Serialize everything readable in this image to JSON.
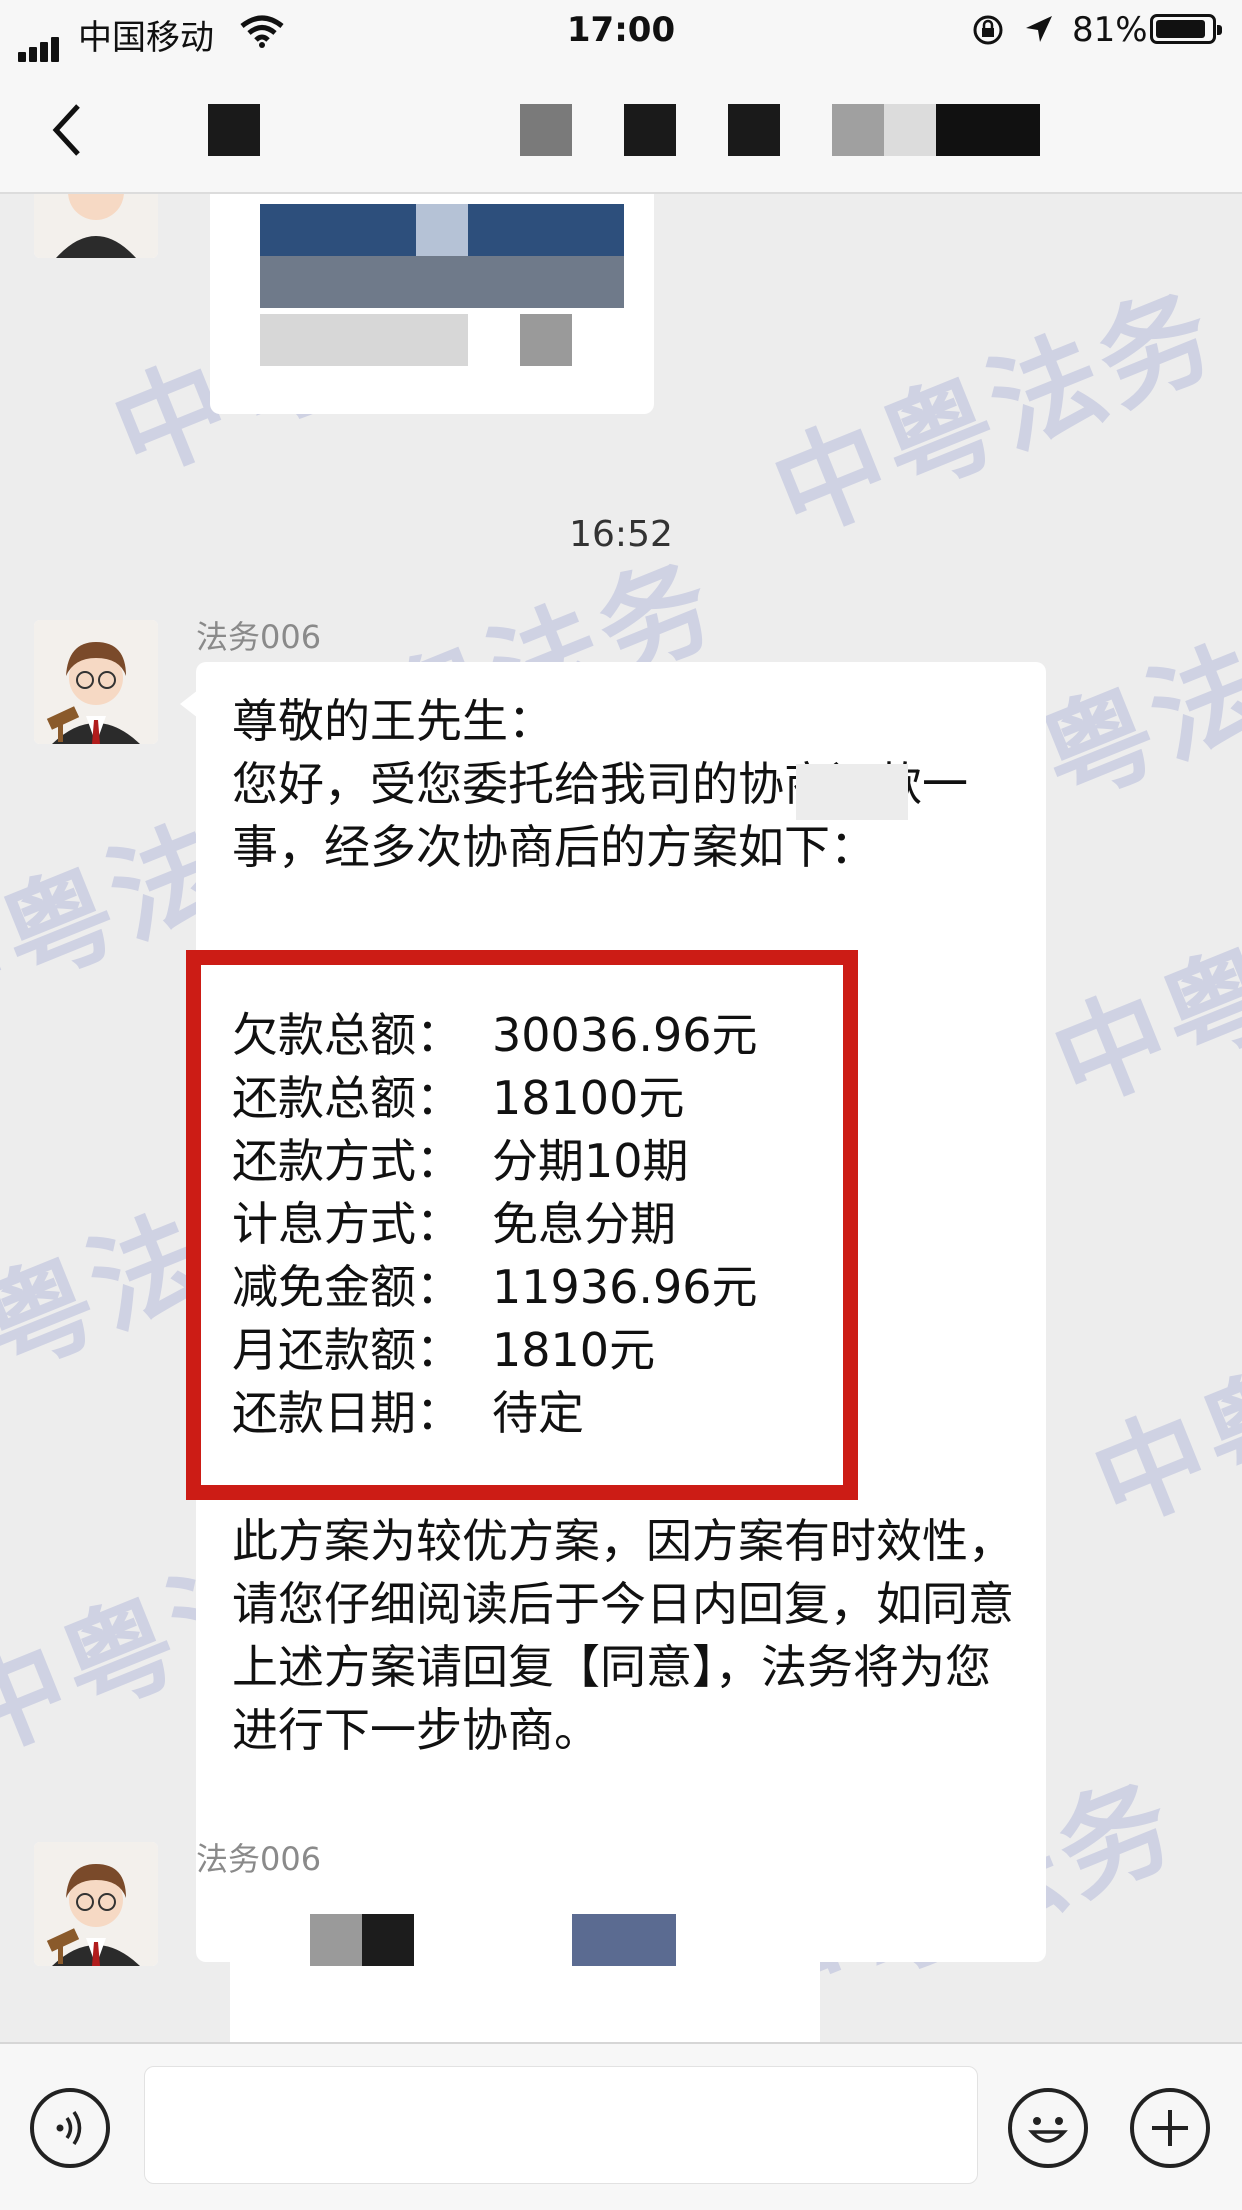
{
  "status_bar": {
    "carrier": "中国移动",
    "time": "17:00",
    "battery": "81%",
    "battery_level": 0.81
  },
  "nav": {
    "back_icon": "chevron-left-icon"
  },
  "chat": {
    "watermark": "中粤法务",
    "time_divider": "16:52",
    "message": {
      "sender": "法务006",
      "greeting": "尊敬的王先生：",
      "intro": "您好，受您委托给我司的协商还款一事，经多次协商后的方案如下：",
      "plan": [
        {
          "label": "欠款总额：",
          "value": "30036.96元"
        },
        {
          "label": "还款总额：",
          "value": "18100元"
        },
        {
          "label": "还款方式：",
          "value": "分期10期"
        },
        {
          "label": "计息方式：",
          "value": "免息分期"
        },
        {
          "label": "减免金额：",
          "value": "11936.96元"
        },
        {
          "label": "月还款额：",
          "value": "1810元"
        },
        {
          "label": "还款日期：",
          "value": "待定"
        }
      ],
      "closing": "此方案为较优方案，因方案有时效性，请您仔细阅读后于今日内回复，如同意上述方案请回复【同意】，法务将为您进行下一步协商。"
    },
    "next_message": {
      "sender": "法务006"
    }
  },
  "input_bar": {
    "voice_icon": "voice-icon",
    "emoji_icon": "emoji-icon",
    "plus_icon": "plus-icon"
  },
  "colors": {
    "highlight_border": "#cc1c15",
    "background": "#ededed",
    "bubble": "#ffffff"
  }
}
